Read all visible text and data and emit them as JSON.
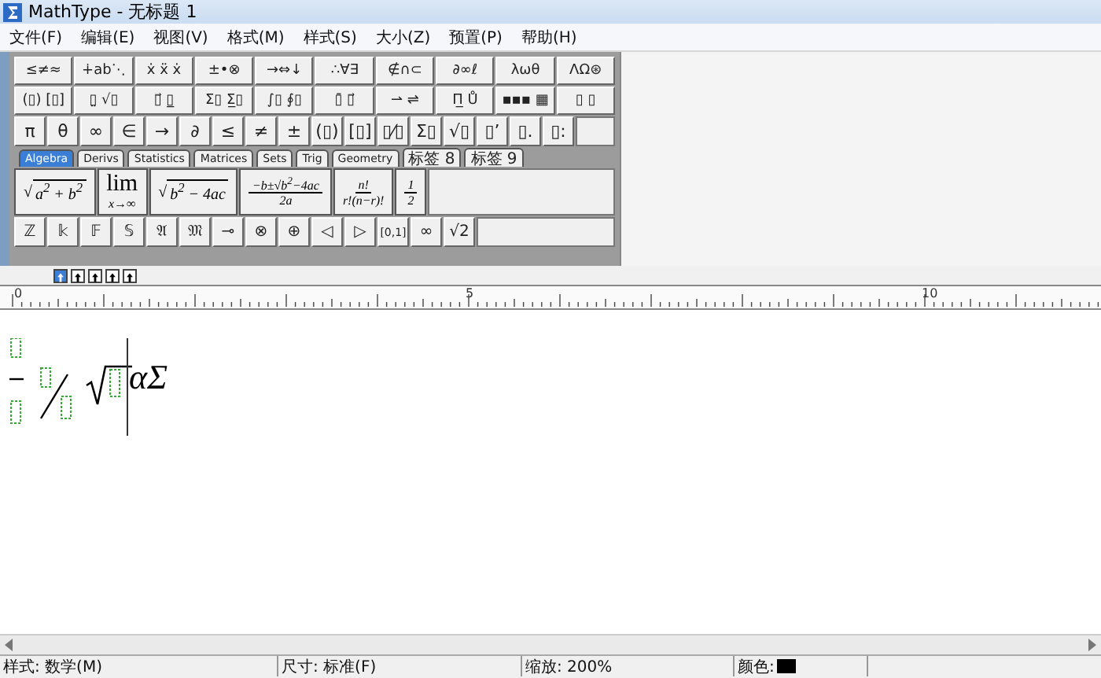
{
  "window": {
    "title": "MathType - 无标题 1"
  },
  "menu": [
    "文件(F)",
    "编辑(E)",
    "视图(V)",
    "格式(M)",
    "样式(S)",
    "大小(Z)",
    "预置(P)",
    "帮助(H)"
  ],
  "symbol_rows": [
    [
      "≤≠≈",
      "∔ab⋱",
      "ẋ ẍ ẋ",
      "±•⊗",
      "→⇔↓",
      "∴∀∃",
      "∉∩⊂",
      "∂∞ℓ",
      "λωθ",
      "ΛΩ⊛"
    ],
    [
      "(▯) [▯]",
      "▯̤ √▯",
      "▯⃗ ▯̲",
      "Σ▯ Σ̲▯",
      "∫▯ ∮▯",
      "▯̄ ▯⃗",
      "⇀ ⇌",
      "Π̲ Ů",
      "▪▪▪ ▦",
      "▯ ▯"
    ]
  ],
  "small_symbols": [
    "π",
    "θ",
    "∞",
    "∈",
    "→",
    "∂",
    "≤",
    "≠",
    "±",
    "(▯)",
    "[▯]",
    "▯⁄▯",
    "Σ▯",
    "√▯",
    "▯ʼ",
    "▯.",
    "▯:"
  ],
  "tabs": [
    {
      "label": "Algebra",
      "selected": true
    },
    {
      "label": "Derivs",
      "selected": false
    },
    {
      "label": "Statistics",
      "selected": false
    },
    {
      "label": "Matrices",
      "selected": false
    },
    {
      "label": "Sets",
      "selected": false
    },
    {
      "label": "Trig",
      "selected": false
    },
    {
      "label": "Geometry",
      "selected": false
    },
    {
      "label": "标签 8",
      "selected": false
    },
    {
      "label": "标签 9",
      "selected": false
    }
  ],
  "templates": [
    {
      "kind": "root",
      "sign": "√",
      "radicand": "a$^{2}$ + b$^{2}$"
    },
    {
      "kind": "limit",
      "top": "lim",
      "bottom": "x→∞"
    },
    {
      "kind": "root",
      "sign": "√",
      "radicand": "b$^{2}$ − 4ac"
    },
    {
      "kind": "fraction",
      "numerator": "−b±√b$^{2}$−4ac",
      "denominator": "2a"
    },
    {
      "kind": "fraction",
      "numerator": "n!",
      "denominator": "r!(n−r)!"
    },
    {
      "kind": "fraction",
      "numerator": "1",
      "denominator": "2"
    }
  ],
  "bottom_symbols": [
    "ℤ",
    "𝕜",
    "𝔽",
    "𝕊",
    "𝔄",
    "𝔐",
    "⊸",
    "⊗",
    "⊕",
    "◁",
    "▷",
    "[0,1]",
    "∞",
    "√2"
  ],
  "size_buttons": [
    {
      "selected": true
    },
    {
      "selected": false
    },
    {
      "selected": false
    },
    {
      "selected": false
    },
    {
      "selected": false
    }
  ],
  "ruler": {
    "labels": [
      "0",
      "5",
      "10"
    ]
  },
  "equation": {
    "text": "αΣ"
  },
  "status_bar": [
    "样式: 数学(M)",
    "尺寸: 标准(F)",
    "缩放: 200%",
    "颜色:"
  ]
}
